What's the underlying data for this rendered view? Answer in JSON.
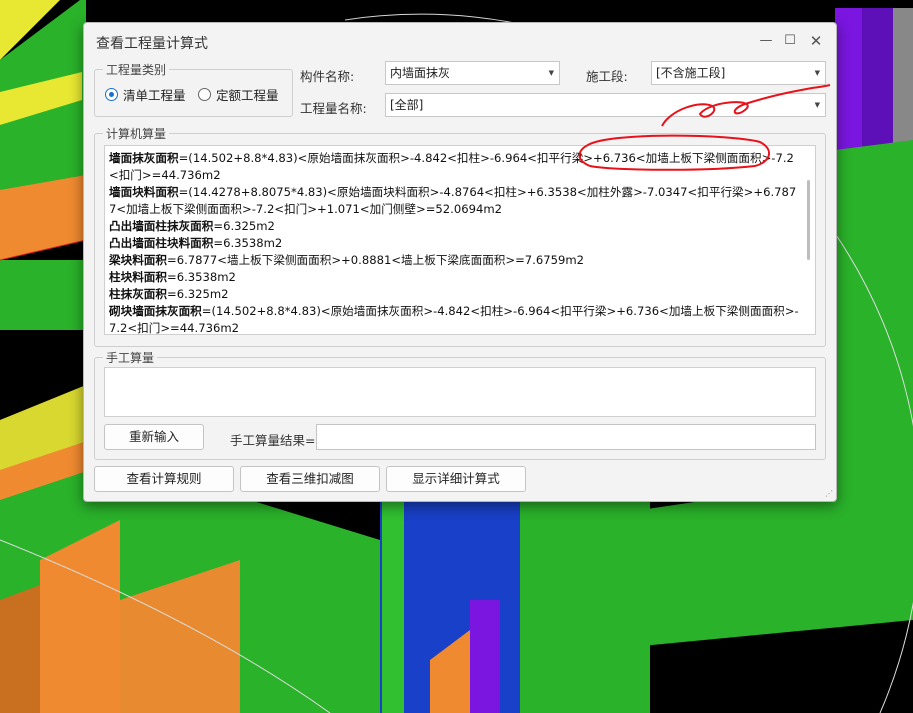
{
  "window": {
    "title": "查看工程量计算式",
    "controls": [
      "minimize-icon",
      "maximize-icon",
      "close-icon"
    ]
  },
  "quantity_category": {
    "legend": "工程量类别",
    "options": [
      {
        "label": "清单工程量",
        "checked": true
      },
      {
        "label": "定额工程量",
        "checked": false
      }
    ]
  },
  "fields": {
    "component_name_label": "构件名称:",
    "component_name_value": "内墙面抹灰",
    "construction_stage_label": "施工段:",
    "construction_stage_value": "[不含施工段]",
    "quantity_name_label": "工程量名称:",
    "quantity_name_value": "[全部]"
  },
  "computer_calc": {
    "legend": "计算机算量",
    "lines": [
      {
        "name": "墙面抹灰面积",
        "expr": "=(14.502+8.8*4.83)<原始墙面抹灰面积>-4.842<扣柱>-6.964<扣平行梁>+6.736<加墙上板下梁侧面面积>-7.2<扣门>=44.736m2"
      },
      {
        "name": "墙面块料面积",
        "expr": "=(14.4278+8.8075*4.83)<原始墙面块料面积>-4.8764<扣柱>+6.3538<加柱外露>-7.0347<扣平行梁>+6.7877<加墙上板下梁侧面面积>-7.2<扣门>+1.071<加门侧壁>=52.0694m2"
      },
      {
        "name": "凸出墙面柱抹灰面积",
        "expr": "=6.325m2"
      },
      {
        "name": "凸出墙面柱块料面积",
        "expr": "=6.3538m2"
      },
      {
        "name": "梁块料面积",
        "expr": "=6.7877<墙上板下梁侧面面积>+0.8881<墙上板下梁底面面积>=7.6759m2"
      },
      {
        "name": "柱块料面积",
        "expr": "=6.3538m2"
      },
      {
        "name": "柱抹灰面积",
        "expr": "=6.325m2"
      },
      {
        "name": "砌块墙面抹灰面积",
        "expr": "=(14.502+8.8*4.83)<原始墙面抹灰面积>-4.842<扣柱>-6.964<扣平行梁>+6.736<加墙上板下梁侧面面积>-7.2<扣门>=44.736m2"
      }
    ]
  },
  "manual_calc": {
    "legend": "手工算量",
    "reenter_button": "重新输入",
    "result_label": "手工算量结果="
  },
  "bottom_buttons": {
    "view_rules": "查看计算规则",
    "view_3d": "查看三维扣减图",
    "show_detail": "显示详细计算式"
  },
  "colors": {
    "annotation": "#e8121a",
    "radio_accent": "#1a6fd1",
    "scene_green": "#2ab22a",
    "scene_purple": "#7a16e0",
    "scene_orange": "#f08a30",
    "scene_yellow": "#e8e832",
    "scene_blue": "#1840c8"
  }
}
